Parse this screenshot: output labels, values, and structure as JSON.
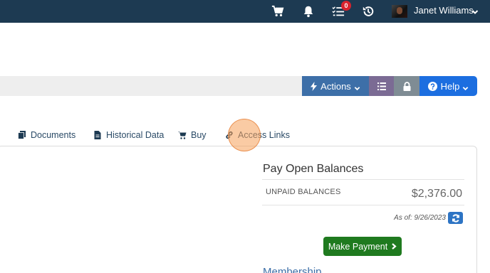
{
  "topbar": {
    "user_name": "Janet Williams",
    "notification_count": "0",
    "icons": [
      "cart-icon",
      "bell-icon",
      "tasks-icon",
      "history-icon",
      "avatar",
      "chevron-down-icon"
    ]
  },
  "toolbar": {
    "actions_label": "Actions",
    "help_label": "Help",
    "colors": {
      "actions": "#3d6fa8",
      "list": "#7b6b94",
      "lock": "#7f8c94",
      "help": "#1c6ee0"
    }
  },
  "tabs": [
    {
      "label": "Documents",
      "icon": "file-icon"
    },
    {
      "label": "Historical Data",
      "icon": "document-icon"
    },
    {
      "label": "Buy",
      "icon": "cart-icon"
    },
    {
      "label": "Access Links",
      "icon": "link-icon"
    }
  ],
  "balances": {
    "title": "Pay Open Balances",
    "unpaid_label": "UNPAID BALANCES",
    "amount": "$2,376.00",
    "as_of": "As of: 9/26/2023",
    "pay_button": "Make Payment",
    "pay_button_color": "#1f7a1f"
  },
  "membership": {
    "title": "Membership"
  }
}
